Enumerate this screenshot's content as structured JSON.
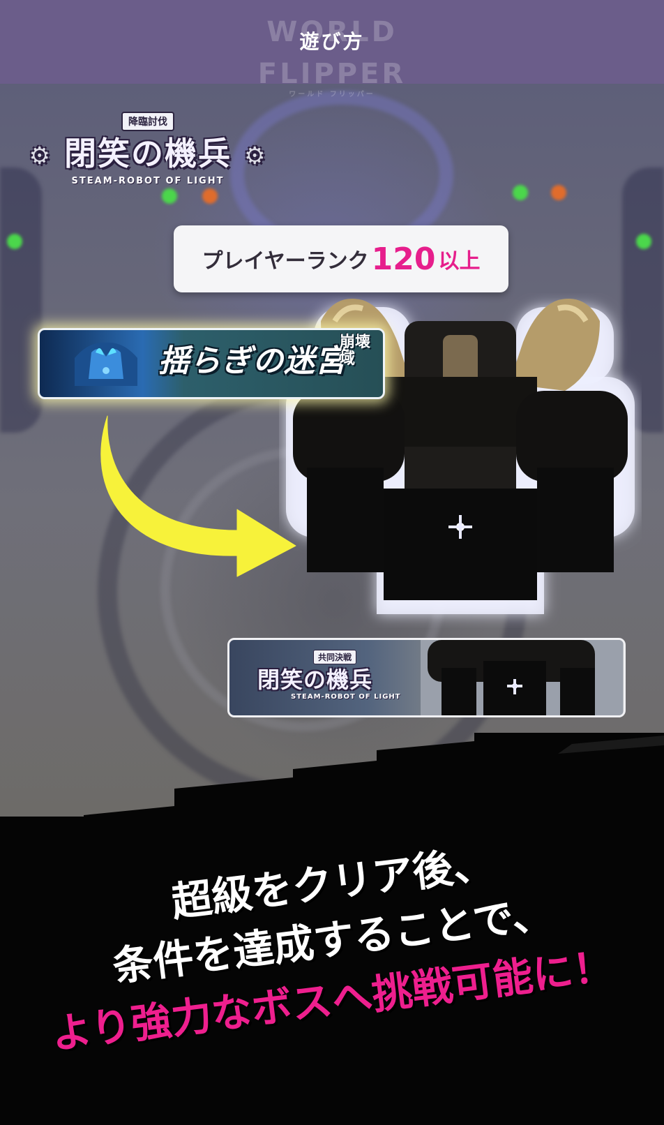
{
  "header": {
    "title": "遊び方",
    "logo_text": "WORLD FLIPPER",
    "logo_subtext": "ワールド フリッパー"
  },
  "event_logo": {
    "tag": "降臨討伐",
    "name": "閉笑の機兵",
    "english": "STEAM-ROBOT OF LIGHT"
  },
  "rank_badge": {
    "label": "プレイヤーランク",
    "number": "120",
    "suffix": "以上"
  },
  "stage_banner": {
    "name": "揺らぎの迷宮",
    "sub": "崩壊域"
  },
  "coop_banner": {
    "tag": "共同決戦",
    "name": "閉笑の機兵",
    "english": "STEAM-ROBOT OF LIGHT"
  },
  "caption": {
    "line1": "超級をクリア後、",
    "line2": "条件を達成することで、",
    "line3": "より強力なボスへ挑戦可能に！"
  },
  "colors": {
    "header_bg": "#6b5d8a",
    "accent_pink": "#e61e8c",
    "arrow_yellow": "#f7f23a",
    "band_black": "#050505"
  },
  "icons": [
    "gear-icon",
    "curved-arrow-icon",
    "boss-robot-icon"
  ]
}
